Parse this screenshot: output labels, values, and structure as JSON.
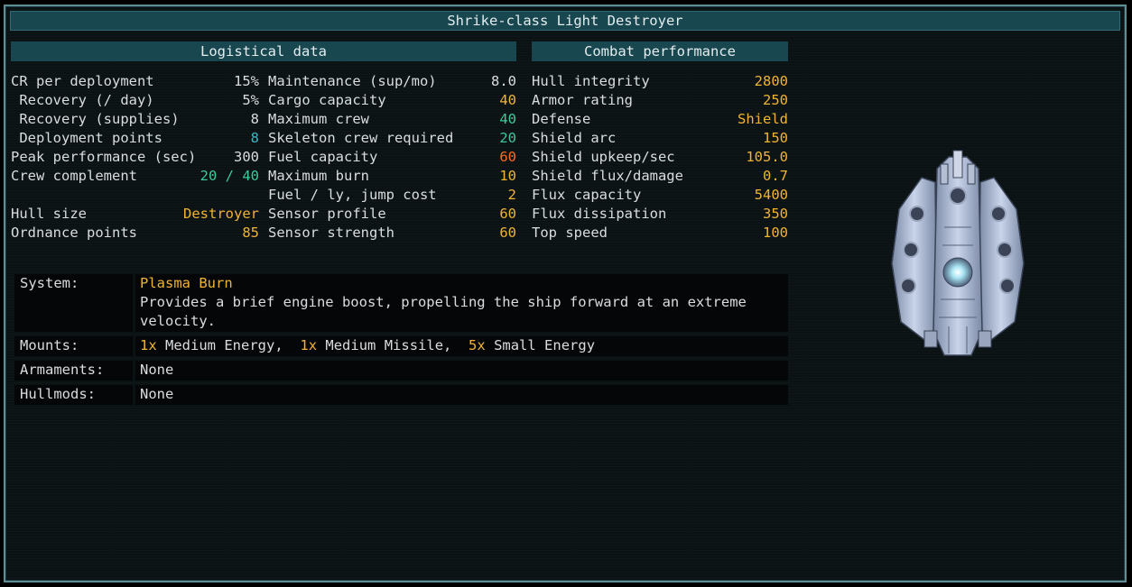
{
  "title": "Shrike-class Light Destroyer",
  "logistical": {
    "header": "Logistical data",
    "col1": [
      {
        "label": "CR per deployment",
        "value": "15%",
        "color": "white"
      },
      {
        "label": " Recovery (/ day)",
        "value": "5%",
        "color": "white"
      },
      {
        "label": " Recovery (supplies)",
        "value": "8",
        "color": "white"
      },
      {
        "label": " Deployment points",
        "value": "8",
        "color": "blue"
      },
      {
        "label": "Peak performance (sec)",
        "value": "300",
        "color": "white"
      },
      {
        "label": "Crew complement",
        "value": "20 / 40",
        "color": "green"
      },
      {
        "label": "",
        "value": "",
        "color": "white"
      },
      {
        "label": "Hull size",
        "value": "Destroyer",
        "color": "yellow"
      },
      {
        "label": "Ordnance points",
        "value": "85",
        "color": "yellow"
      }
    ],
    "col2": [
      {
        "label": "Maintenance (sup/mo)",
        "value": "8.0",
        "color": "white"
      },
      {
        "label": "Cargo capacity",
        "value": "40",
        "color": "yellow"
      },
      {
        "label": "Maximum crew",
        "value": "40",
        "color": "green"
      },
      {
        "label": "Skeleton crew required",
        "value": "20",
        "color": "green"
      },
      {
        "label": "Fuel capacity",
        "value": "60",
        "color": "orange"
      },
      {
        "label": "Maximum burn",
        "value": "10",
        "color": "yellow"
      },
      {
        "label": "Fuel / ly, jump cost",
        "value": "2",
        "color": "yellow"
      },
      {
        "label": "Sensor profile",
        "value": "60",
        "color": "yellow"
      },
      {
        "label": "Sensor strength",
        "value": "60",
        "color": "yellow"
      }
    ]
  },
  "combat": {
    "header": "Combat performance",
    "rows": [
      {
        "label": "Hull integrity",
        "value": "2800",
        "color": "yellow"
      },
      {
        "label": "Armor rating",
        "value": "250",
        "color": "yellow"
      },
      {
        "label": "Defense",
        "value": "Shield",
        "color": "yellow"
      },
      {
        "label": "Shield arc",
        "value": "150",
        "color": "yellow"
      },
      {
        "label": "Shield upkeep/sec",
        "value": "105.0",
        "color": "yellow"
      },
      {
        "label": "Shield flux/damage",
        "value": "0.7",
        "color": "yellow"
      },
      {
        "label": "Flux capacity",
        "value": "5400",
        "color": "yellow"
      },
      {
        "label": "Flux dissipation",
        "value": "350",
        "color": "yellow"
      },
      {
        "label": "Top speed",
        "value": "100",
        "color": "yellow"
      }
    ]
  },
  "details": {
    "system": {
      "label": "System:",
      "name": "Plasma Burn",
      "description": "Provides a brief engine boost, propelling the ship forward at an extreme velocity."
    },
    "mounts": {
      "label": "Mounts:",
      "items": [
        {
          "count": "1x",
          "type": "Medium Energy",
          "sep": ", "
        },
        {
          "count": "1x",
          "type": "Medium Missile",
          "sep": ", "
        },
        {
          "count": "5x",
          "type": "Small Energy",
          "sep": ""
        }
      ]
    },
    "armaments": {
      "label": "Armaments:",
      "value": "None"
    },
    "hullmods": {
      "label": "Hullmods:",
      "value": "None"
    }
  },
  "ship_image": {
    "icon": "shrike-destroyer-sprite"
  }
}
